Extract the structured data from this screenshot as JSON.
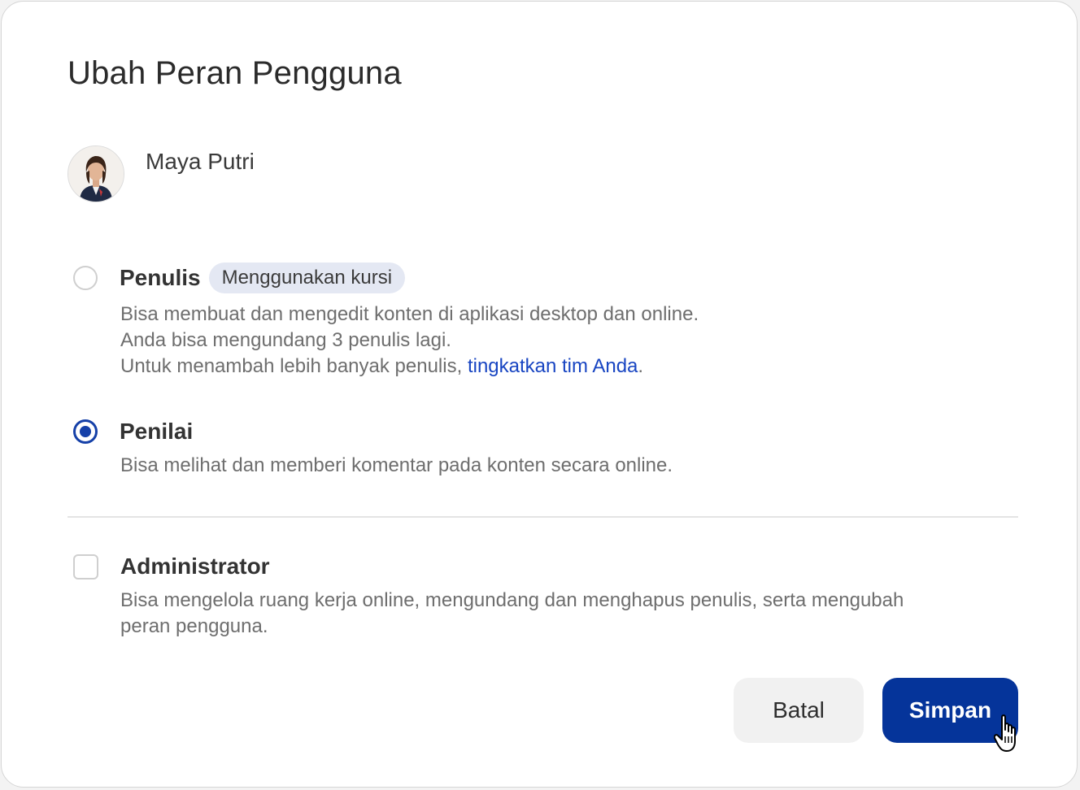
{
  "dialog": {
    "title": "Ubah Peran Pengguna"
  },
  "user": {
    "name": "Maya Putri"
  },
  "options": [
    {
      "label": "Penulis",
      "badge": "Menggunakan kursi",
      "selected": false,
      "desc_lines": [
        "Bisa membuat dan mengedit konten di aplikasi desktop dan online.",
        "Anda bisa mengundang 3 penulis lagi."
      ],
      "desc_prefix": "Untuk menambah lebih banyak penulis, ",
      "link_text": "tingkatkan tim Anda",
      "desc_suffix": "."
    },
    {
      "label": "Penilai",
      "selected": true,
      "desc": "Bisa melihat dan memberi komentar pada konten secara online."
    }
  ],
  "admin": {
    "label": "Administrator",
    "checked": false,
    "desc_line1": "Bisa mengelola ruang kerja online, mengundang dan menghapus penulis, serta mengubah",
    "desc_line2": "peran pengguna."
  },
  "buttons": {
    "cancel": "Batal",
    "save": "Simpan"
  },
  "colors": {
    "accent": "#05349a",
    "link": "#1845c2",
    "badge_bg": "#e4e8f3"
  },
  "icons": {
    "cursor": "hand-pointer-icon"
  }
}
